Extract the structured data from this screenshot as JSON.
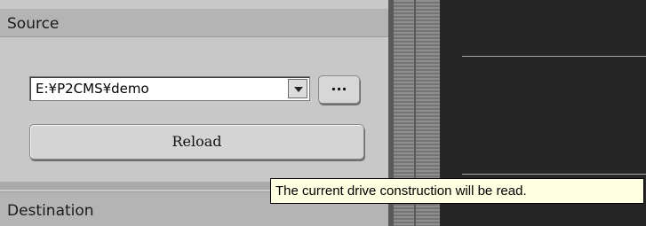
{
  "source": {
    "header": "Source",
    "path_value": "E:¥P2CMS¥demo",
    "browse_label": "...",
    "reload_label": "Reload"
  },
  "destination": {
    "header": "Destination"
  },
  "tooltip": {
    "text": "The current drive construction will be read."
  }
}
